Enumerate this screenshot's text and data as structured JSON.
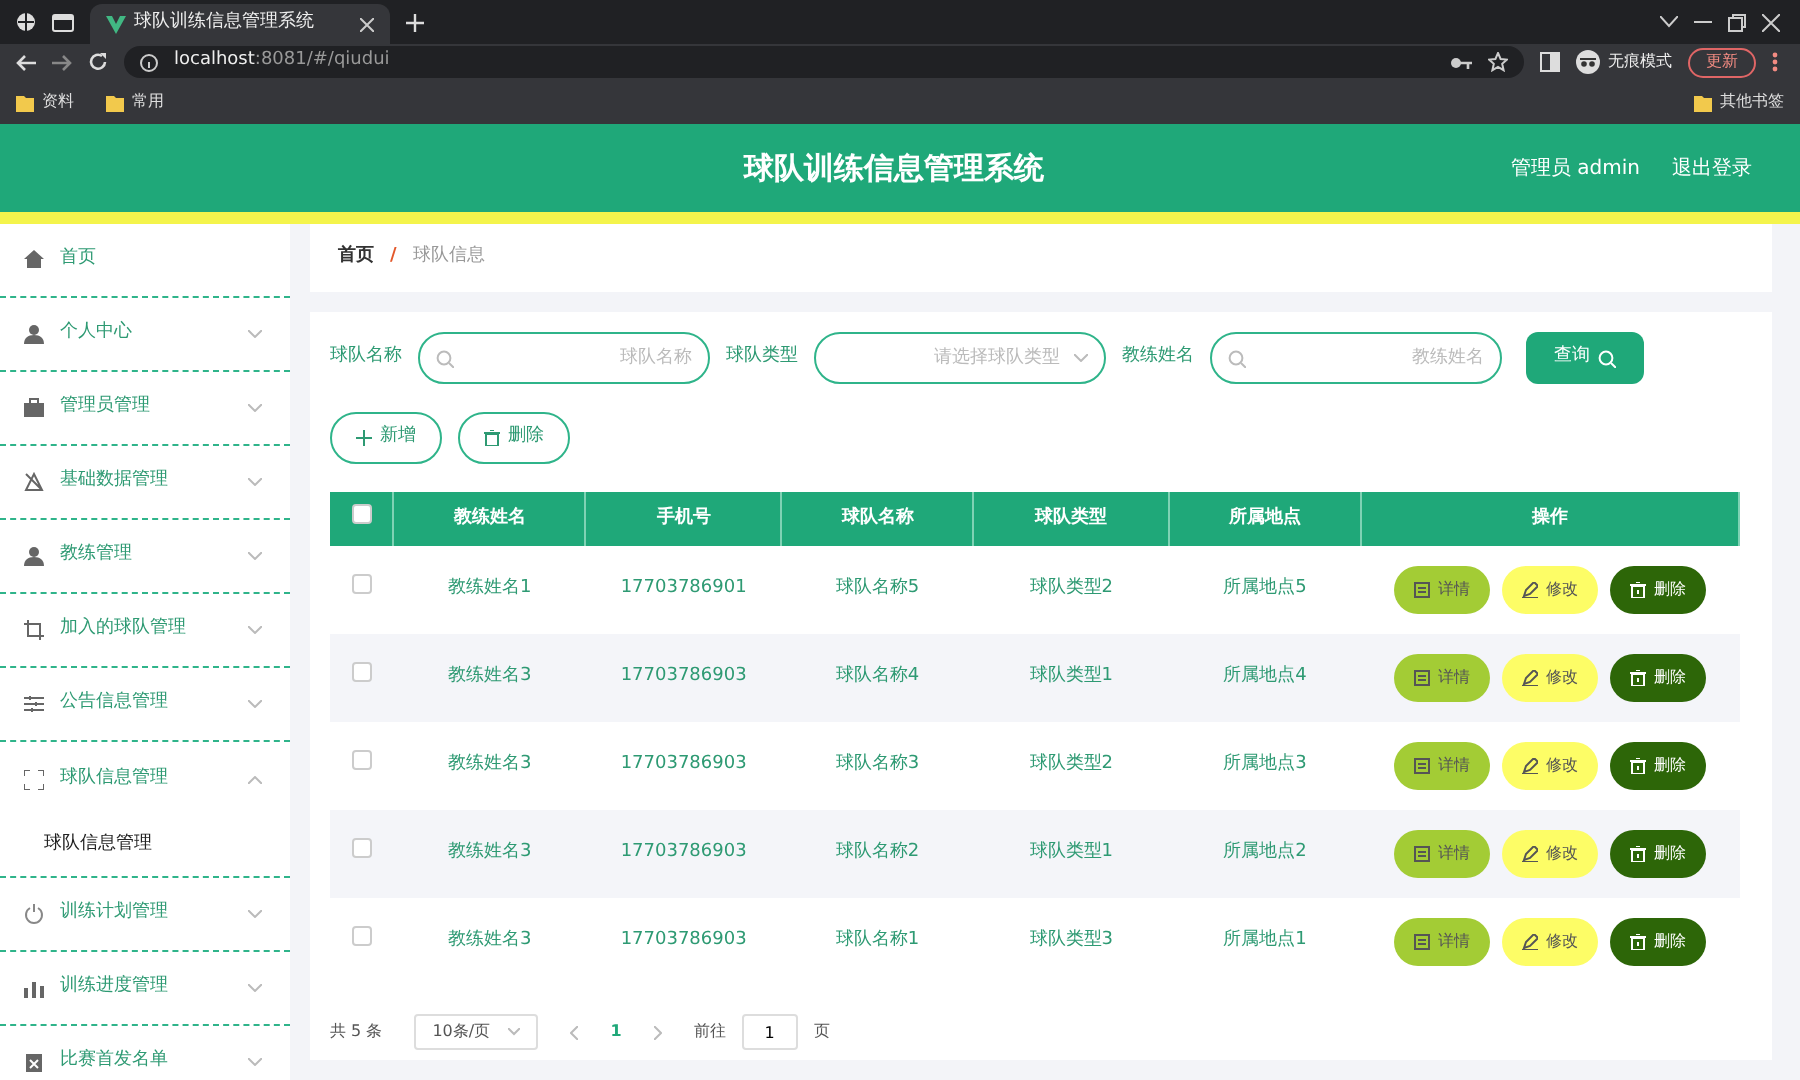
{
  "browser": {
    "tab_title": "球队训练信息管理系统",
    "url_host": "localhost",
    "url_rest": ":8081/#/qiudui",
    "profile": "无痕模式",
    "update": "更新",
    "bookmarks": [
      "资料",
      "常用"
    ],
    "other_bookmarks": "其他书签"
  },
  "header": {
    "title": "球队训练信息管理系统",
    "user": "管理员 admin",
    "logout": "退出登录"
  },
  "sidebar": {
    "items": [
      {
        "label": "首页"
      },
      {
        "label": "个人中心",
        "expanded": false
      },
      {
        "label": "管理员管理",
        "expanded": false
      },
      {
        "label": "基础数据管理",
        "expanded": false
      },
      {
        "label": "教练管理",
        "expanded": false
      },
      {
        "label": "加入的球队管理",
        "expanded": false
      },
      {
        "label": "公告信息管理",
        "expanded": false
      },
      {
        "label": "球队信息管理",
        "expanded": true,
        "children": [
          {
            "label": "球队信息管理"
          }
        ]
      },
      {
        "label": "训练计划管理",
        "expanded": false
      },
      {
        "label": "训练进度管理",
        "expanded": false
      },
      {
        "label": "比赛首发名单",
        "expanded": false
      }
    ]
  },
  "breadcrumb": {
    "items": [
      "首页",
      "球队信息"
    ],
    "separator": "/"
  },
  "search": {
    "fields": [
      {
        "label": "球队名称",
        "kind": "text",
        "placeholder": "球队名称"
      },
      {
        "label": "球队类型",
        "kind": "select",
        "placeholder": "请选择球队类型"
      },
      {
        "label": "教练姓名",
        "kind": "text",
        "placeholder": "教练姓名"
      }
    ],
    "button": "查询"
  },
  "actions": [
    "新增",
    "删除"
  ],
  "table": {
    "select_all_checked": false,
    "columns": [
      "教练姓名",
      "手机号",
      "球队名称",
      "球队类型",
      "所属地点",
      "操作"
    ],
    "rows": [
      {
        "checked": false,
        "cells": [
          "教练姓名1",
          "17703786901",
          "球队名称5",
          "球队类型2",
          "所属地点5"
        ],
        "buttons": [
          "详情",
          "修改",
          "删除"
        ]
      },
      {
        "checked": false,
        "cells": [
          "教练姓名3",
          "17703786903",
          "球队名称4",
          "球队类型1",
          "所属地点4"
        ],
        "buttons": [
          "详情",
          "修改",
          "删除"
        ]
      },
      {
        "checked": false,
        "cells": [
          "教练姓名3",
          "17703786903",
          "球队名称3",
          "球队类型2",
          "所属地点3"
        ],
        "buttons": [
          "详情",
          "修改",
          "删除"
        ]
      },
      {
        "checked": false,
        "cells": [
          "教练姓名3",
          "17703786903",
          "球队名称2",
          "球队类型1",
          "所属地点2"
        ],
        "buttons": [
          "详情",
          "修改",
          "删除"
        ]
      },
      {
        "checked": false,
        "cells": [
          "教练姓名3",
          "17703786903",
          "球队名称1",
          "球队类型3",
          "所属地点1"
        ],
        "buttons": [
          "详情",
          "修改",
          "删除"
        ]
      }
    ]
  },
  "pagination": {
    "total": "共 5 条",
    "page_size": "10条/页",
    "pages": [
      {
        "label": "1",
        "selected": true
      }
    ],
    "goto_label": "前往",
    "goto_value": "1",
    "page_unit": "页"
  }
}
